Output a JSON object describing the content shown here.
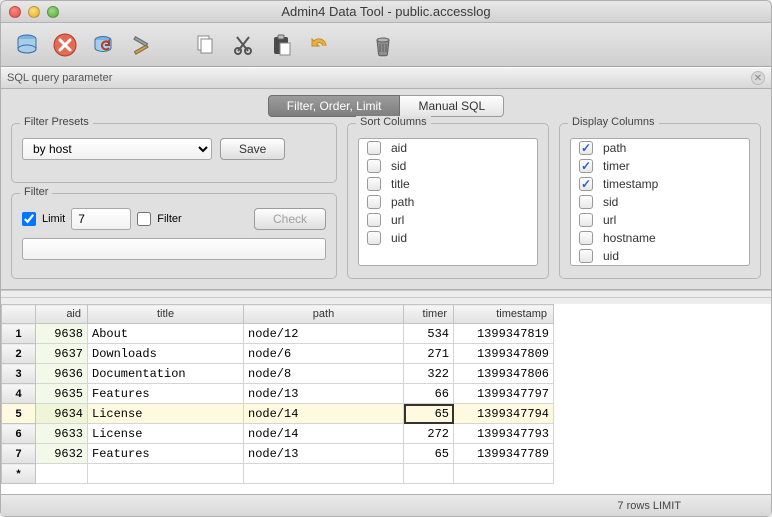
{
  "window": {
    "title": "Admin4 Data Tool - public.accesslog"
  },
  "panel": {
    "title": "SQL query parameter"
  },
  "tabs": {
    "filter": "Filter, Order, Limit",
    "manual": "Manual SQL"
  },
  "presets": {
    "legend": "Filter Presets",
    "selected": "by host",
    "save": "Save"
  },
  "filter": {
    "legend": "Filter",
    "limit_label": "Limit",
    "limit_value": "7",
    "filter_label": "Filter",
    "check": "Check",
    "text": ""
  },
  "sort": {
    "legend": "Sort Columns",
    "items": [
      {
        "label": "aid",
        "checked": false
      },
      {
        "label": "sid",
        "checked": false
      },
      {
        "label": "title",
        "checked": false
      },
      {
        "label": "path",
        "checked": false
      },
      {
        "label": "url",
        "checked": false
      },
      {
        "label": "uid",
        "checked": false
      }
    ]
  },
  "display": {
    "legend": "Display Columns",
    "items": [
      {
        "label": "path",
        "checked": true
      },
      {
        "label": "timer",
        "checked": true
      },
      {
        "label": "timestamp",
        "checked": true
      },
      {
        "label": "sid",
        "checked": false
      },
      {
        "label": "url",
        "checked": false
      },
      {
        "label": "hostname",
        "checked": false
      },
      {
        "label": "uid",
        "checked": false
      }
    ]
  },
  "grid": {
    "headers": {
      "aid": "aid",
      "title": "title",
      "path": "path",
      "timer": "timer",
      "timestamp": "timestamp"
    },
    "rows": [
      {
        "n": "1",
        "aid": "9638",
        "title": "About",
        "path": "node/12",
        "timer": "534",
        "timestamp": "1399347819",
        "hl": false
      },
      {
        "n": "2",
        "aid": "9637",
        "title": "Downloads",
        "path": "node/6",
        "timer": "271",
        "timestamp": "1399347809",
        "hl": false
      },
      {
        "n": "3",
        "aid": "9636",
        "title": "Documentation",
        "path": "node/8",
        "timer": "322",
        "timestamp": "1399347806",
        "hl": false
      },
      {
        "n": "4",
        "aid": "9635",
        "title": "Features",
        "path": "node/13",
        "timer": "66",
        "timestamp": "1399347797",
        "hl": false
      },
      {
        "n": "5",
        "aid": "9634",
        "title": "License",
        "path": "node/14",
        "timer": "65",
        "timestamp": "1399347794",
        "hl": true
      },
      {
        "n": "6",
        "aid": "9633",
        "title": "License",
        "path": "node/14",
        "timer": "272",
        "timestamp": "1399347793",
        "hl": false
      },
      {
        "n": "7",
        "aid": "9632",
        "title": "Features",
        "path": "node/13",
        "timer": "65",
        "timestamp": "1399347789",
        "hl": false
      }
    ],
    "star": "*"
  },
  "status": "7 rows LIMIT"
}
